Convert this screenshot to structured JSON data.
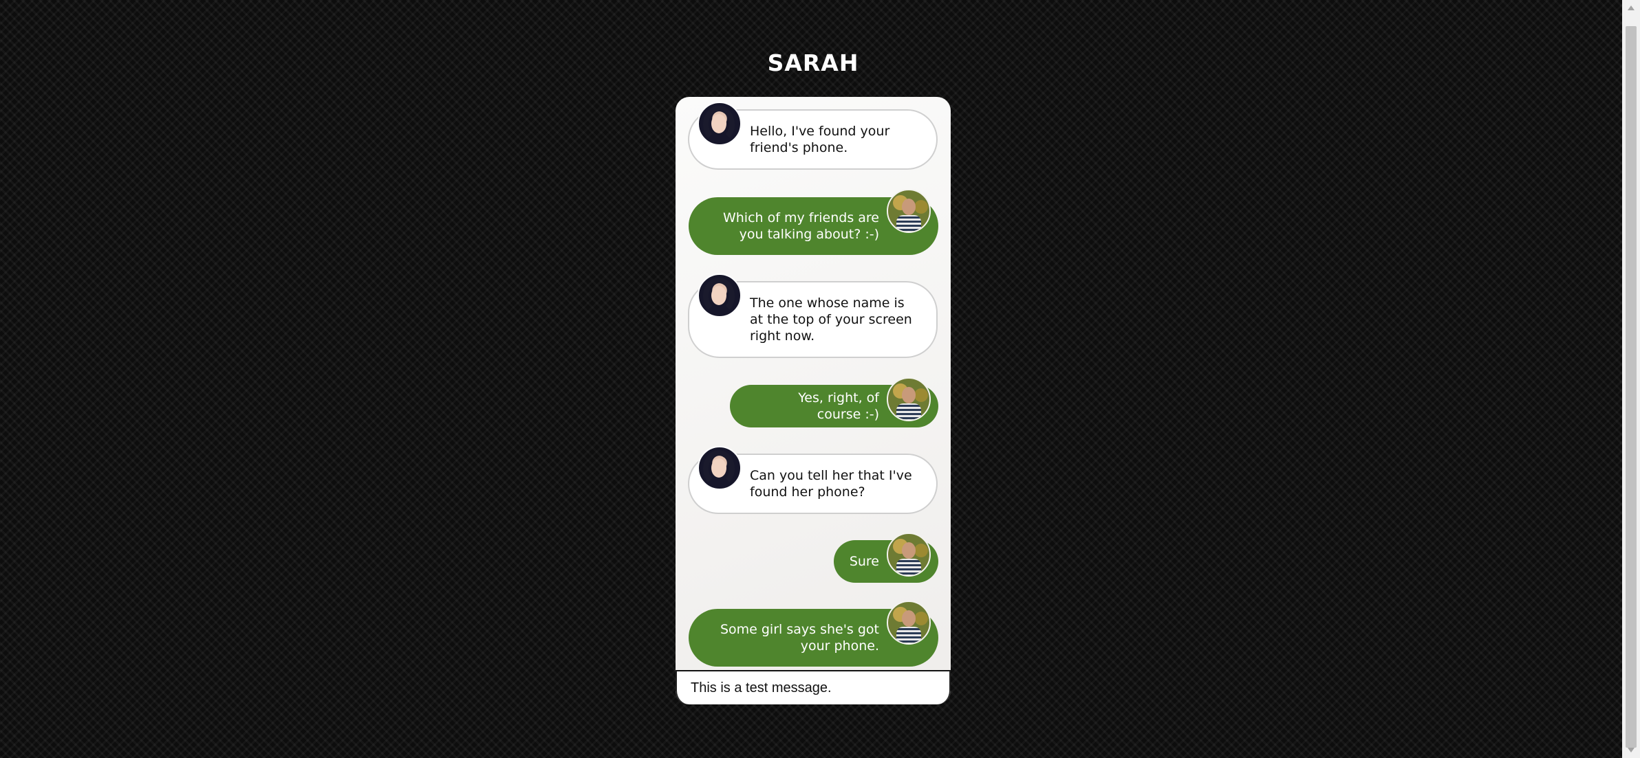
{
  "header": {
    "contact_name": "SARAH"
  },
  "messages": [
    {
      "from": "her",
      "text": "Hello, I've found your friend's phone."
    },
    {
      "from": "me",
      "text": "Which of my friends are you talking about? :-)"
    },
    {
      "from": "her",
      "text": "The one whose name is at the top of your screen right now."
    },
    {
      "from": "me",
      "text": "Yes, right, of course :-)"
    },
    {
      "from": "her",
      "text": "Can you tell her that I've found her phone?"
    },
    {
      "from": "me",
      "text": "Sure"
    },
    {
      "from": "me",
      "text": "Some girl says she's got your phone."
    }
  ],
  "composer": {
    "value": "This is a test message."
  },
  "icons": {
    "her_avatar": "avatar-photo-woman",
    "my_avatar": "avatar-photo-man"
  },
  "colors": {
    "outgoing_bubble": "#4f852d",
    "incoming_bubble": "#ffffff",
    "background": "#0d0d0d"
  }
}
